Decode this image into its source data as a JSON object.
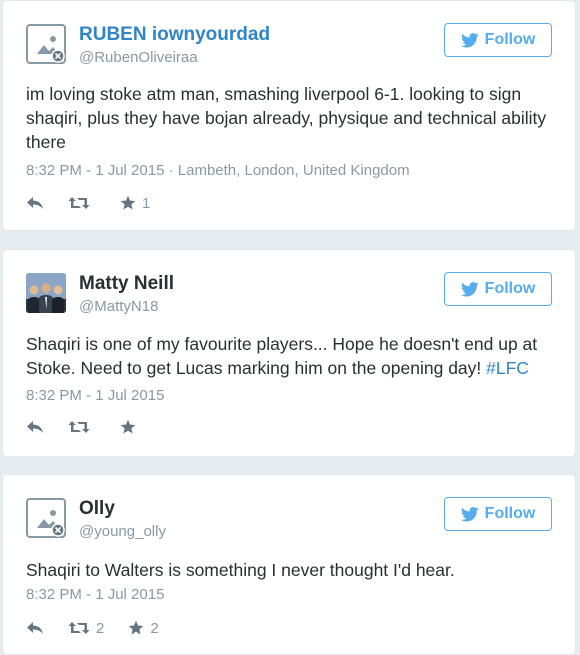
{
  "tweets": [
    {
      "name": "RUBEN iownyourdad",
      "handle": "@RubenOliveiraa",
      "follow_label": "Follow",
      "text": "im loving stoke atm man, smashing liverpool 6-1. looking to sign shaqiri, plus they have bojan already, physique and technical ability there",
      "timestamp": "8:32 PM - 1 Jul 2015",
      "location": "Lambeth, London, United Kingdom",
      "retweets": "",
      "favorites": "1",
      "avatar_icon": "default-avatar-icon"
    },
    {
      "name": "Matty Neill",
      "handle": "@MattyN18",
      "follow_label": "Follow",
      "text_before": "Shaqiri is one of my favourite players... Hope he doesn't end up at Stoke. Need to get Lucas marking him on the opening day! ",
      "hashtag": "#LFC",
      "timestamp": "8:32 PM - 1 Jul 2015",
      "retweets": "",
      "favorites": "",
      "avatar_icon": "profile-photo"
    },
    {
      "name": "Olly",
      "handle": "@young_olly",
      "follow_label": "Follow",
      "text": "Shaqiri to Walters is something I never thought I'd hear.",
      "timestamp": "8:32 PM - 1 Jul 2015",
      "retweets": "2",
      "favorites": "2",
      "avatar_icon": "default-avatar-icon"
    }
  ],
  "colors": {
    "accent": "#55acee",
    "link": "#2f85c7",
    "muted": "#8899a6",
    "text": "#292f33"
  }
}
